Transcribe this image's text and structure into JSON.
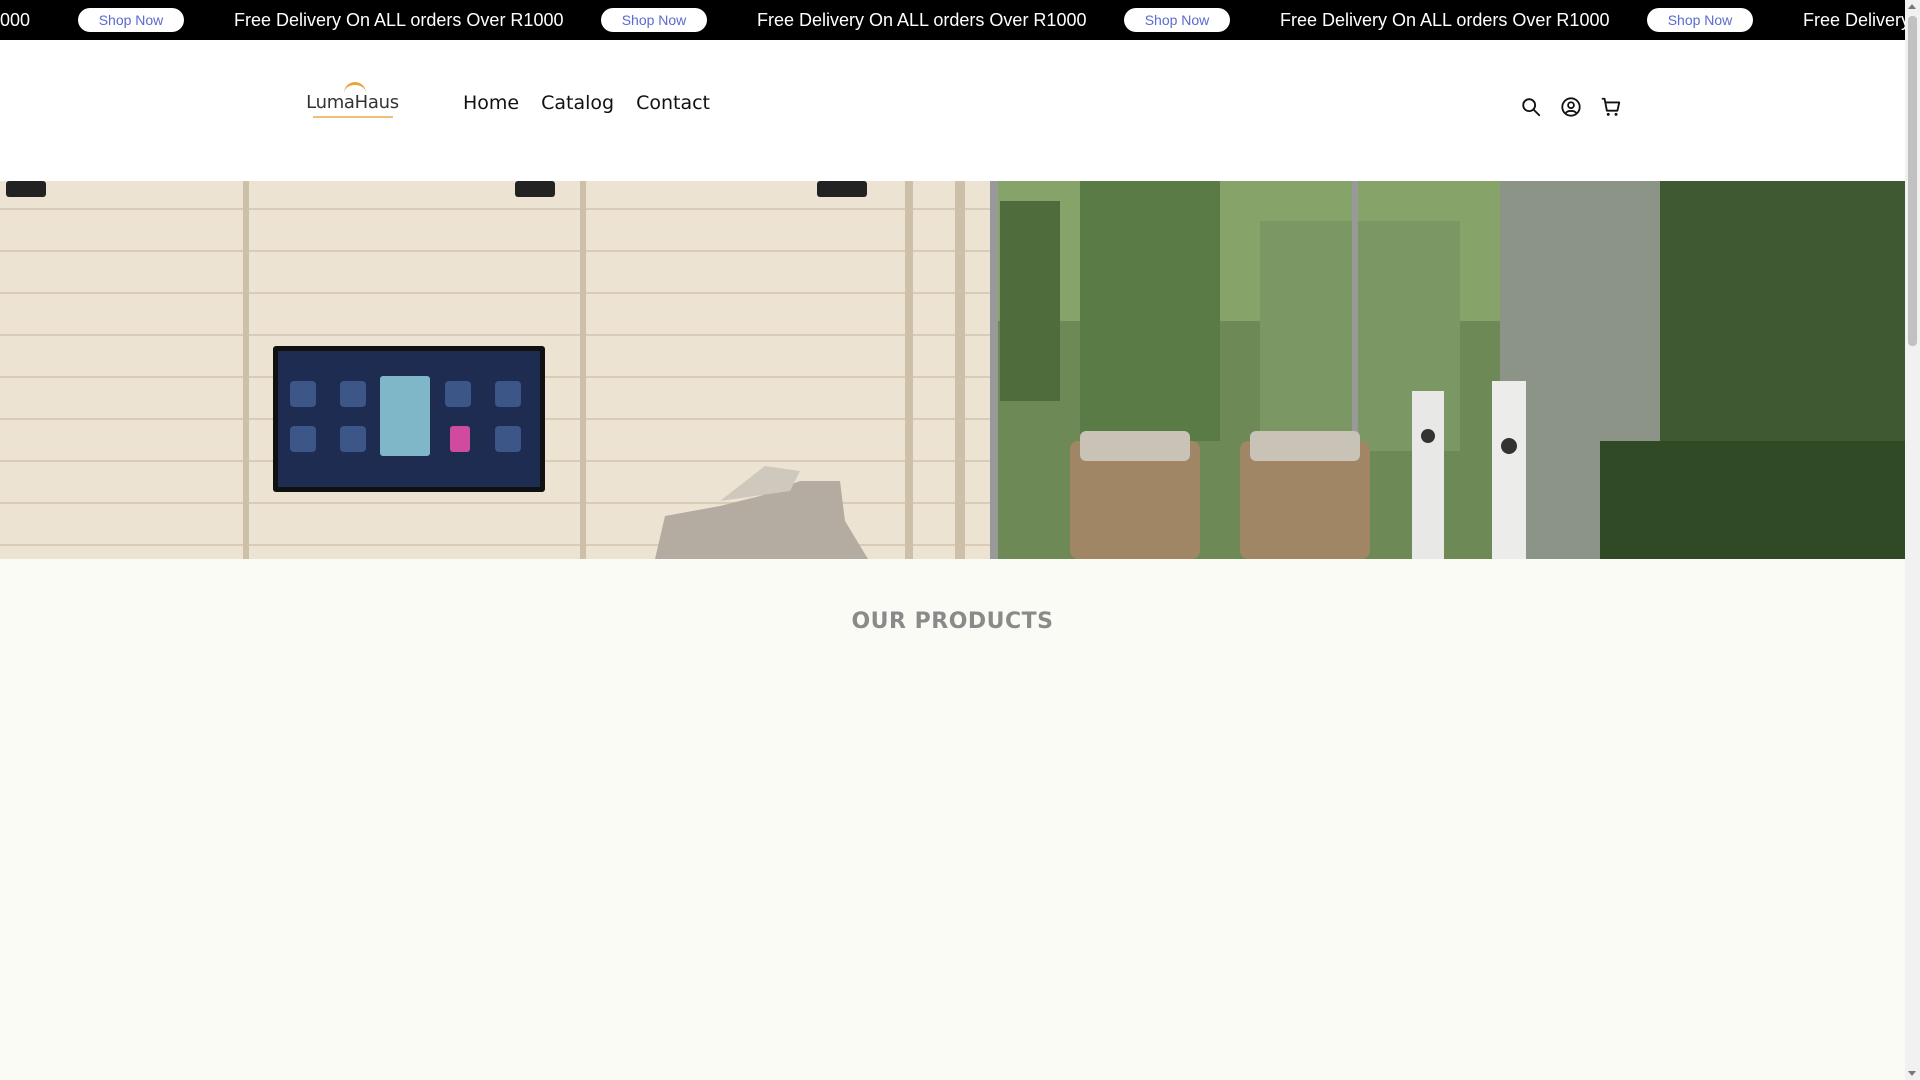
{
  "announcement": {
    "message": "Free Delivery On ALL orders Over R1000",
    "fragment_start": "000",
    "fragment_end": "Free Delivery",
    "button_label": "Shop Now"
  },
  "header": {
    "logo_text": "LumaHaus",
    "nav": [
      "Home",
      "Catalog",
      "Contact"
    ],
    "icons": [
      "search-icon",
      "account-icon",
      "cart-icon"
    ]
  },
  "products": {
    "title": "OUR PRODUCTS"
  },
  "colors": {
    "announcement_bg": "#000000",
    "button_text": "#5b6ad0",
    "logo_accent": "#e8a43b",
    "page_bg": "#fbfbf5"
  }
}
